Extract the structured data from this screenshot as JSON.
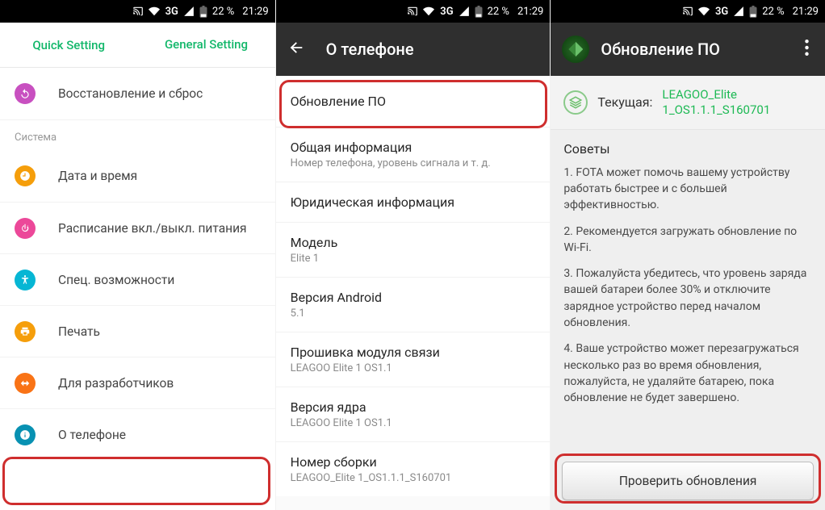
{
  "status": {
    "network": "3G",
    "battery": "22 %",
    "time": "21:29"
  },
  "screen1": {
    "tabs": [
      "Quick Setting",
      "General Setting"
    ],
    "rows": [
      {
        "icon": "ci-purple",
        "label": "Восстановление и сброс",
        "iconName": "restore-icon"
      },
      {
        "section": "Система"
      },
      {
        "icon": "ci-orange",
        "label": "Дата и время",
        "iconName": "clock-icon"
      },
      {
        "icon": "ci-pink",
        "label": "Расписание вкл./выкл. питания",
        "iconName": "power-icon"
      },
      {
        "icon": "ci-teal",
        "label": "Спец. возможности",
        "iconName": "accessibility-icon"
      },
      {
        "icon": "ci-yellow",
        "label": "Печать",
        "iconName": "print-icon"
      },
      {
        "icon": "ci-ored",
        "label": "Для разработчиков",
        "iconName": "developer-icon"
      },
      {
        "icon": "ci-cyan",
        "label": "О телефоне",
        "iconName": "info-icon"
      }
    ]
  },
  "screen2": {
    "title": "О телефоне",
    "items": [
      {
        "title": "Обновление ПО"
      },
      {
        "title": "Общая информация",
        "sub": "Номер телефона, уровень сигнала и т. д."
      },
      {
        "title": "Юридическая информация"
      },
      {
        "title": "Модель",
        "sub": "Elite 1"
      },
      {
        "title": "Версия Android",
        "sub": "5.1"
      },
      {
        "title": "Прошивка модуля связи",
        "sub": "LEAGOO Elite 1 OS1.1"
      },
      {
        "title": "Версия ядра",
        "sub": "LEAGOO Elite 1 OS1.1"
      },
      {
        "title": "Номер сборки",
        "sub": "LEAGOO_Elite 1_OS1.1.1_S160701"
      }
    ]
  },
  "screen3": {
    "title": "Обновление ПО",
    "current_label": "Текущая:",
    "current_version": "LEAGOO_Elite 1_OS1.1.1_S160701",
    "tips_title": "Советы",
    "tips": [
      "1. FOTA может помочь вашему устройству работать быстрее и с большей эффективностью.",
      "2. Рекомендуется загружать обновление по Wi-Fi.",
      "3. Пожалуйста убедитесь, что уровень заряда вашей батареи более 30% и отключите зарядное устройство перед началом обновления.",
      "4. Ваше устройство может перезагружаться несколько раз во время обновления, пожалуйста, не удаляйте батарею, пока обновление не будет завершено."
    ],
    "check_button": "Проверить обновления"
  }
}
